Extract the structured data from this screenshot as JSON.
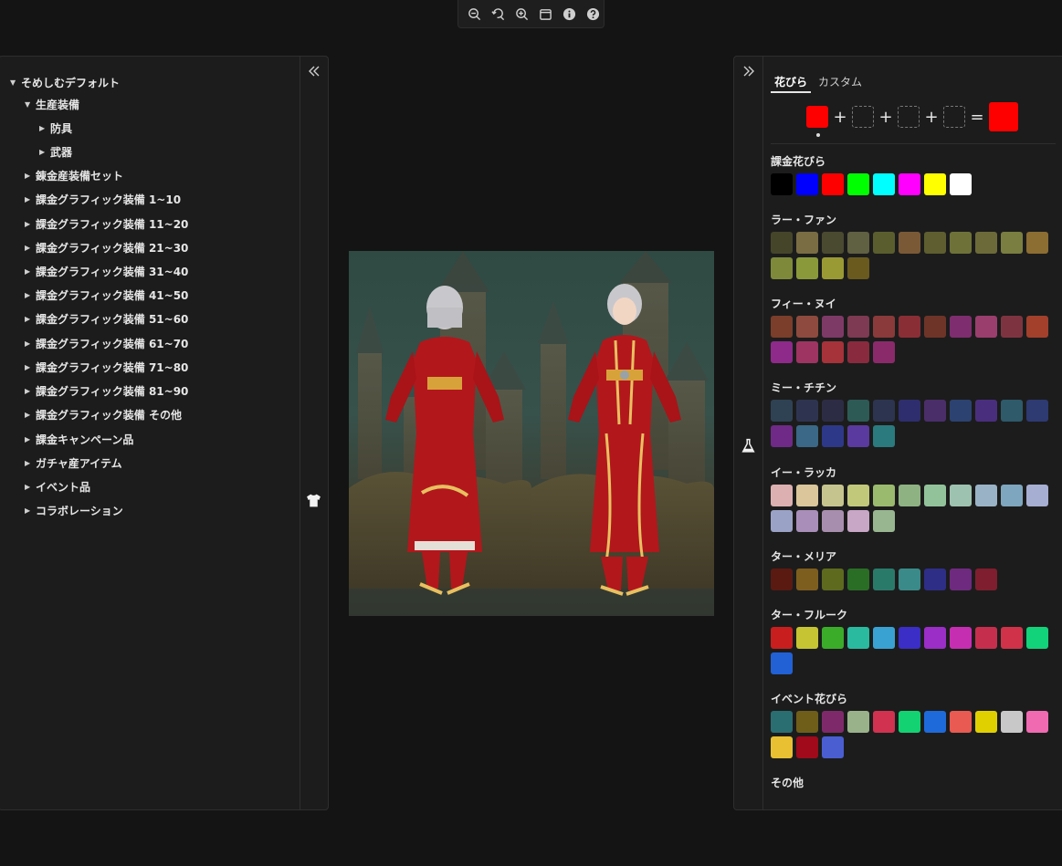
{
  "toolbar": {
    "buttons": [
      "zoom-out-icon",
      "zoom-reset-icon",
      "zoom-in-icon",
      "window-icon",
      "info-icon",
      "help-icon"
    ]
  },
  "tree": {
    "items": [
      {
        "label": "そめしむデフォルト",
        "level": 0,
        "expanded": true
      },
      {
        "label": "生産装備",
        "level": 1,
        "expanded": true
      },
      {
        "label": "防具",
        "level": 2,
        "expanded": false
      },
      {
        "label": "武器",
        "level": 2,
        "expanded": false
      },
      {
        "label": "錬金産装備セット",
        "level": 1,
        "expanded": false
      },
      {
        "label": "課金グラフィック装備 1~10",
        "level": 1,
        "expanded": false
      },
      {
        "label": "課金グラフィック装備 11~20",
        "level": 1,
        "expanded": false
      },
      {
        "label": "課金グラフィック装備 21~30",
        "level": 1,
        "expanded": false
      },
      {
        "label": "課金グラフィック装備 31~40",
        "level": 1,
        "expanded": false
      },
      {
        "label": "課金グラフィック装備 41~50",
        "level": 1,
        "expanded": false
      },
      {
        "label": "課金グラフィック装備 51~60",
        "level": 1,
        "expanded": false
      },
      {
        "label": "課金グラフィック装備 61~70",
        "level": 1,
        "expanded": false
      },
      {
        "label": "課金グラフィック装備 71~80",
        "level": 1,
        "expanded": false
      },
      {
        "label": "課金グラフィック装備 81~90",
        "level": 1,
        "expanded": false
      },
      {
        "label": "課金グラフィック装備 その他",
        "level": 1,
        "expanded": false
      },
      {
        "label": "課金キャンペーン品",
        "level": 1,
        "expanded": false
      },
      {
        "label": "ガチャ産アイテム",
        "level": 1,
        "expanded": false
      },
      {
        "label": "イベント品",
        "level": 1,
        "expanded": false
      },
      {
        "label": "コラボレーション",
        "level": 1,
        "expanded": false
      }
    ]
  },
  "right": {
    "tabs": [
      "花びら",
      "カスタム"
    ],
    "active_tab": 0,
    "mix": {
      "slot1": "#ff0000",
      "op_plus": "+",
      "op_equals": "=",
      "result": "#ff0000"
    },
    "sections": [
      {
        "title": "課金花びら",
        "colors": [
          "#000000",
          "#0000ff",
          "#ff0000",
          "#00ff00",
          "#00ffff",
          "#ff00ff",
          "#ffff00",
          "#ffffff"
        ]
      },
      {
        "title": "ラー・ファン",
        "colors": [
          "#45452a",
          "#7a6d44",
          "#4a4a30",
          "#606042",
          "#5a5e2e",
          "#7a5a36",
          "#5e5e30",
          "#6e7238",
          "#6c6a38",
          "#7a7e40",
          "#8c6e32",
          "#7e8a3a",
          "#8a9a3a",
          "#9a9a34",
          "#6a5a1e"
        ]
      },
      {
        "title": "フィー・ヌイ",
        "colors": [
          "#7a3e2a",
          "#8e4a3e",
          "#7e3a66",
          "#7e3a52",
          "#8a3a3a",
          "#8a2e36",
          "#6e3428",
          "#7e2e6e",
          "#9a3e6e",
          "#7e3440",
          "#a2402c",
          "#8e2a8a",
          "#9e3462",
          "#a6323a",
          "#8a2a3e",
          "#8a2a6a"
        ]
      },
      {
        "title": "ミー・チチン",
        "colors": [
          "#2e4254",
          "#2e3450",
          "#2c2c44",
          "#2e5a56",
          "#2c3450",
          "#2e2e6e",
          "#4a2e6a",
          "#2c4270",
          "#4a2e7e",
          "#2e5a6a",
          "#2e3a72",
          "#6e2a86",
          "#3a6886",
          "#2e3888",
          "#5a3a9e",
          "#2a7a7e"
        ]
      },
      {
        "title": "イー・ラッカ",
        "colors": [
          "#dcb0b0",
          "#dac69a",
          "#c6c48e",
          "#c2c87a",
          "#9aba6e",
          "#8eb282",
          "#92c29a",
          "#9ec2b0",
          "#9ab2c6",
          "#7ea6be",
          "#a6aed2",
          "#9aa2c6",
          "#a88eb8",
          "#a88eae",
          "#c8a6c6",
          "#98b690"
        ]
      },
      {
        "title": "ター・メリア",
        "colors": [
          "#5a1a12",
          "#7e5e1e",
          "#5e6a1e",
          "#2a6e26",
          "#2a7a6a",
          "#3a8a8a",
          "#2e2e86",
          "#6e2a7e",
          "#7e1e2e"
        ]
      },
      {
        "title": "ター・フルーク",
        "colors": [
          "#c81e1e",
          "#c6c432",
          "#3aac2a",
          "#2abaa0",
          "#3aa2d2",
          "#3a2ec6",
          "#9a2ec6",
          "#c62eb2",
          "#c62e4e",
          "#d0324a",
          "#12d27a",
          "#2260d6"
        ]
      },
      {
        "title": "イベント花びら",
        "colors": [
          "#2a6e72",
          "#6e5e1a",
          "#7e2a6a",
          "#9ab28a",
          "#d03250",
          "#12d272",
          "#1e6ada",
          "#e85a52",
          "#e0d000",
          "#c8c8c8",
          "#f06ab2",
          "#e8c032",
          "#a00a1a",
          "#4a5ed2"
        ]
      },
      {
        "title": "その他",
        "colors": []
      }
    ]
  },
  "colors": {
    "bg": "#141414",
    "panel": "#1c1c1c",
    "border": "#2e2e2e",
    "text": "#e6e6e6",
    "outfit_red": "#b2171c",
    "outfit_gold": "#e8c060"
  }
}
